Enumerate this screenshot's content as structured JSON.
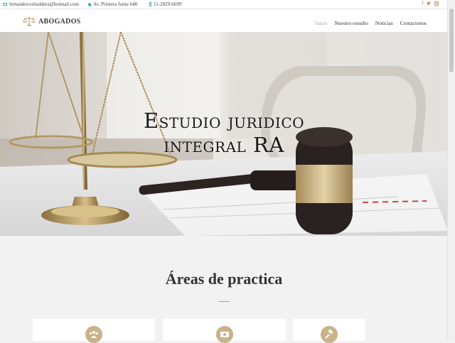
{
  "topbar": {
    "email": "fernandocorinaldera@hotmail.com",
    "address": "Av. Primera Junta 648",
    "phone": "11-2829-6699",
    "social": [
      "facebook-icon",
      "twitter-icon",
      "instagram-icon"
    ]
  },
  "brand": {
    "name": "ABOGADOS"
  },
  "nav": {
    "items": [
      "Inicio",
      "Nuestro estudio",
      "Noticias",
      "Contactenos"
    ],
    "active": "Inicio"
  },
  "hero": {
    "line1": "Estudio juridico",
    "line2": "integral RA"
  },
  "practice": {
    "title": "Áreas de practica"
  },
  "cards": [
    {
      "icon": "people-icon"
    },
    {
      "icon": "money-icon"
    },
    {
      "icon": "gavel-icon"
    }
  ],
  "colors": {
    "accent": "#b7a07b",
    "contact_icon": "#2bb3a3"
  }
}
